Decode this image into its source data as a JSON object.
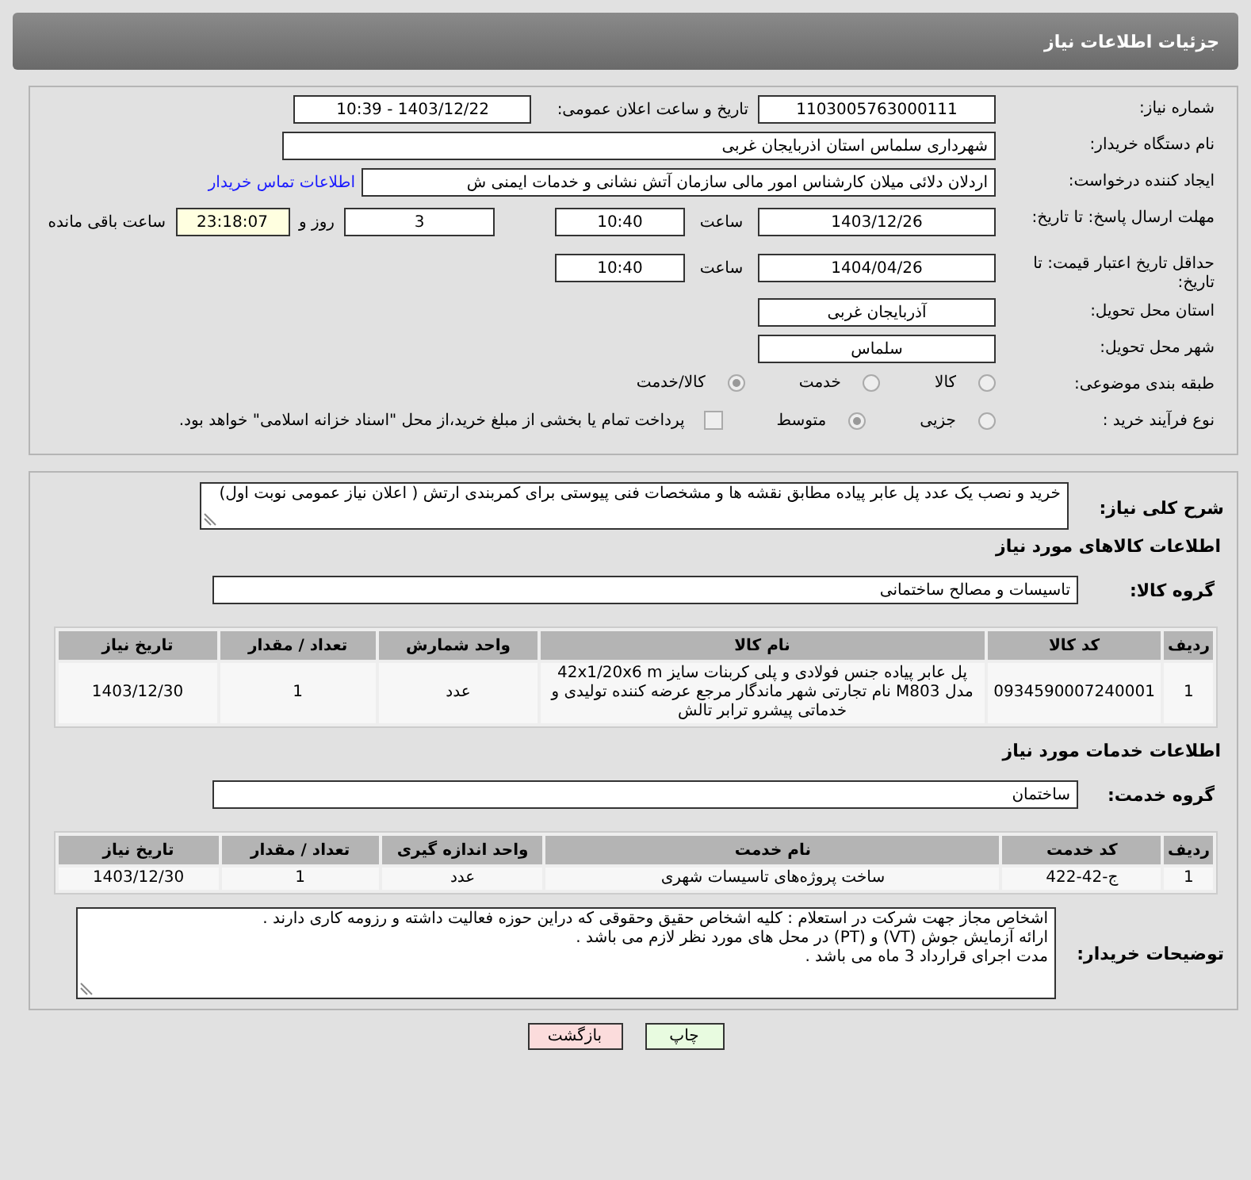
{
  "header": {
    "title": "جزئیات اطلاعات نیاز"
  },
  "details": [
    {
      "kind": "pair",
      "label": "شماره نیاز:",
      "value": "1103005763000111",
      "label2": "تاریخ و ساعت اعلان عمومی:",
      "value2": "1403/12/22 - 10:39"
    },
    {
      "kind": "wide",
      "label": "نام دستگاه خریدار:",
      "value": "شهرداری سلماس استان اذربایجان غربی"
    },
    {
      "kind": "link",
      "label": "ایجاد کننده درخواست:",
      "value": "اردلان دلائی میلان کارشناس امور مالی سازمان آتش نشانی و خدمات ایمنی ش",
      "link": "اطلاعات تماس خریدار"
    },
    {
      "kind": "deadline",
      "label": "مهلت ارسال پاسخ: تا تاریخ:",
      "date": "1403/12/26",
      "time_label": "ساعت",
      "time": "10:40",
      "days": "3",
      "days_label": "روز و",
      "remaining": "23:18:07",
      "remaining_label": "ساعت باقی مانده"
    },
    {
      "kind": "deadline",
      "label": "حداقل تاریخ اعتبار قیمت: تا تاریخ:",
      "date": "1404/04/26",
      "time_label": "ساعت",
      "time": "10:40"
    },
    {
      "kind": "short",
      "label": "استان محل تحویل:",
      "value": "آذربایجان غربی"
    },
    {
      "kind": "short",
      "label": "شهر محل تحویل:",
      "value": "سلماس"
    },
    {
      "kind": "radios",
      "label": "طبقه بندی موضوعی:",
      "options": [
        {
          "label": "کالا",
          "selected": false
        },
        {
          "label": "خدمت",
          "selected": false
        },
        {
          "label": "کالا/خدمت",
          "selected": true
        }
      ]
    },
    {
      "kind": "radios",
      "label": "نوع فرآیند خرید :",
      "options": [
        {
          "label": "جزیی",
          "selected": false
        },
        {
          "label": "متوسط",
          "selected": true
        }
      ],
      "checkbox": {
        "label": "پرداخت تمام یا بخشی از مبلغ خرید،از محل \"اسناد خزانه اسلامی\" خواهد بود.",
        "checked": false
      }
    }
  ],
  "summary": {
    "label": "شرح کلی نیاز:",
    "value": "خرید و نصب یک عدد پل عابر پیاده مطابق نقشه ها و مشخصات فنی پیوستی برای کمربندی ارتش ( اعلان نیاز عمومی نوبت اول)"
  },
  "goods": {
    "heading": "اطلاعات کالاهای مورد نیاز",
    "group_label": "گروه کالا:",
    "group": "تاسیسات و مصالح ساختمانی",
    "columns": [
      "ردیف",
      "کد کالا",
      "نام کالا",
      "واحد شمارش",
      "تعداد / مقدار",
      "تاریخ نیاز"
    ],
    "rows": [
      [
        "1",
        "0934590007240001",
        "پل عابر پیاده جنس فولادی و پلی کربنات سایز 42x1/20x6 m مدل M803 نام تجارتی شهر ماندگار مرجع عرضه کننده تولیدی و خدماتی پیشرو ترابر تالش",
        "عدد",
        "1",
        "1403/12/30"
      ]
    ]
  },
  "services": {
    "heading": "اطلاعات خدمات مورد نیاز",
    "group_label": "گروه خدمت:",
    "group": "ساختمان",
    "columns": [
      "ردیف",
      "کد خدمت",
      "نام خدمت",
      "واحد اندازه گیری",
      "تعداد / مقدار",
      "تاریخ نیاز"
    ],
    "rows": [
      [
        "1",
        "ج-42-422",
        "ساخت پروژه‌های تاسیسات شهری",
        "عدد",
        "1",
        "1403/12/30"
      ]
    ]
  },
  "notes": {
    "label": "توضیحات خریدار:",
    "value": "اشخاص مجاز جهت شرکت در استعلام : کلیه اشخاص حقیق وحقوقی که دراین حوزه فعالیت داشته و رزومه کاری دارند .\nارائه آزمایش جوش (VT) و (PT) در محل های مورد نظر لازم می باشد .\nمدت اجرای قرارداد 3 ماه می باشد ."
  },
  "buttons": [
    {
      "kind": "print",
      "label": "چاپ"
    },
    {
      "kind": "back",
      "label": "بازگشت"
    }
  ]
}
